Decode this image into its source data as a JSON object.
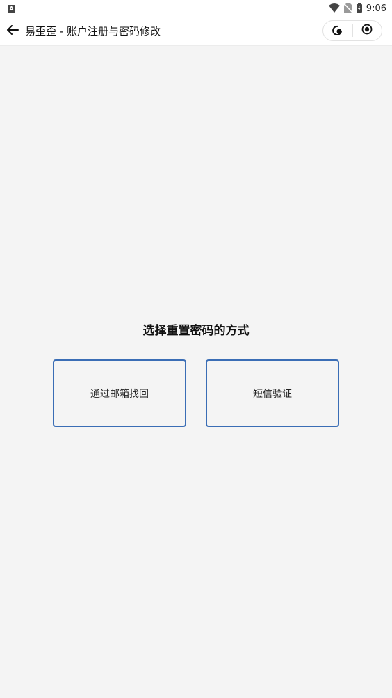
{
  "status_bar": {
    "notification_icon_letter": "A",
    "time": "9:06",
    "icons": [
      "wifi-icon",
      "no-sim-icon",
      "battery-charging-icon"
    ]
  },
  "nav": {
    "title": "易歪歪 - 账户注册与密码修改",
    "back_icon": "arrow-left-icon",
    "capsule_icons": [
      "more-dots-icon",
      "close-target-icon"
    ]
  },
  "main": {
    "heading": "选择重置密码的方式",
    "options": [
      {
        "label": "通过邮箱找回"
      },
      {
        "label": "短信验证"
      }
    ]
  },
  "colors": {
    "accent_border": "#3a6db5",
    "background": "#f4f4f4"
  }
}
